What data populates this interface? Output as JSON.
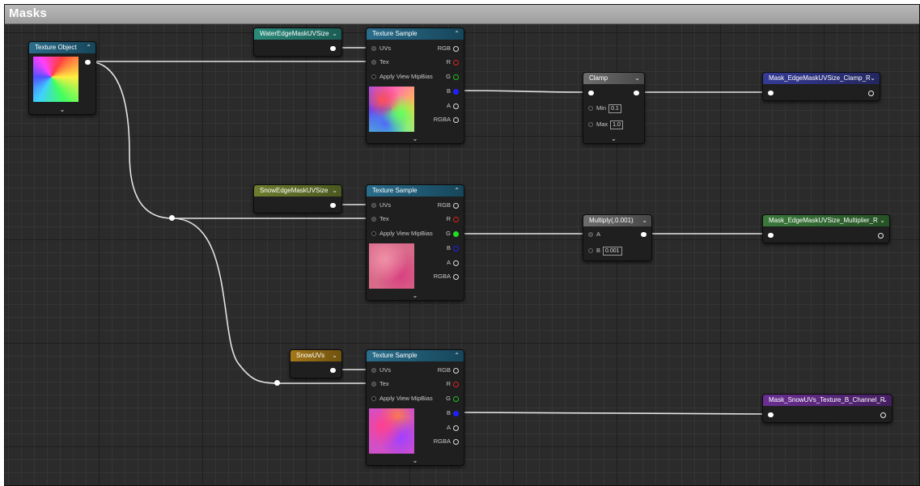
{
  "panel": {
    "title": "Masks"
  },
  "texture_object": {
    "title": "Texture Object",
    "footer": "⌄"
  },
  "params": {
    "water": {
      "label": "WaterEdgeMaskUVSize"
    },
    "snow": {
      "label": "SnowEdgeMaskUVSize"
    },
    "snowuvs": {
      "label": "SnowUVs"
    }
  },
  "texture_sample": {
    "title": "Texture Sample",
    "inputs": {
      "uvs": "UVs",
      "tex": "Tex",
      "mip": "Apply View MipBias"
    },
    "outputs": {
      "rgb": "RGB",
      "r": "R",
      "g": "G",
      "b": "B",
      "a": "A",
      "rgba": "RGBA"
    },
    "footer": "⌄"
  },
  "clamp": {
    "title": "Clamp",
    "min_label": "Min",
    "min_value": "0.1",
    "max_label": "Max",
    "max_value": "1.0",
    "footer": "⌄"
  },
  "multiply": {
    "title": "Multiply(,0.001)",
    "a_label": "A",
    "b_label": "B",
    "b_value": "0.001"
  },
  "outputs": {
    "clamp_r": "Mask_EdgeMaskUVSize_Clamp_R",
    "mult_r": "Mask_EdgeMaskUVSize_Multiplier_R",
    "snow_b": "Mask_SnowUVs_Texture_B_Channel_R"
  },
  "icons": {
    "collapse": "chevron-up-icon",
    "expand": "chevron-down-icon"
  },
  "colors": {
    "r_pin": "#e02020",
    "g_pin": "#20d020",
    "b_pin": "#2020ff",
    "wire": "#e8e8e8"
  }
}
